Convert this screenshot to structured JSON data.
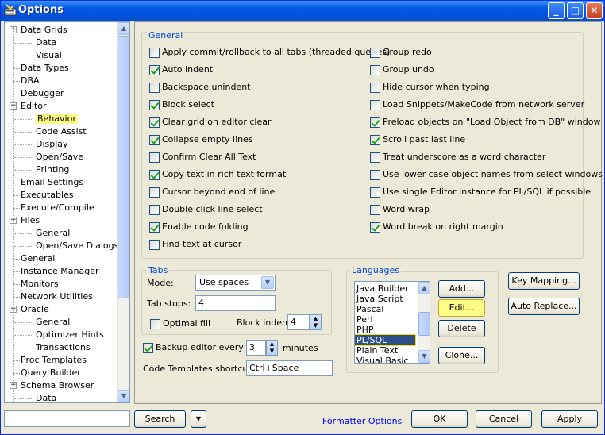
{
  "window": {
    "title": "Options",
    "min": "_",
    "max": "□",
    "close": "✕"
  },
  "tree": {
    "items": [
      {
        "label": "Data Grids",
        "level": 0,
        "expander": "−"
      },
      {
        "label": "Data",
        "level": 1
      },
      {
        "label": "Visual",
        "level": 1
      },
      {
        "label": "Data Types",
        "level": 0
      },
      {
        "label": "DBA",
        "level": 0
      },
      {
        "label": "Debugger",
        "level": 0
      },
      {
        "label": "Editor",
        "level": 0,
        "expander": "−"
      },
      {
        "label": "Behavior",
        "level": 1,
        "selected": true
      },
      {
        "label": "Code Assist",
        "level": 1
      },
      {
        "label": "Display",
        "level": 1
      },
      {
        "label": "Open/Save",
        "level": 1
      },
      {
        "label": "Printing",
        "level": 1
      },
      {
        "label": "Email Settings",
        "level": 0
      },
      {
        "label": "Executables",
        "level": 0
      },
      {
        "label": "Execute/Compile",
        "level": 0
      },
      {
        "label": "Files",
        "level": 0,
        "expander": "−"
      },
      {
        "label": "General",
        "level": 1
      },
      {
        "label": "Open/Save Dialogs",
        "level": 1
      },
      {
        "label": "General",
        "level": 0
      },
      {
        "label": "Instance Manager",
        "level": 0
      },
      {
        "label": "Monitors",
        "level": 0
      },
      {
        "label": "Network Utilities",
        "level": 0
      },
      {
        "label": "Oracle",
        "level": 0,
        "expander": "−"
      },
      {
        "label": "General",
        "level": 1
      },
      {
        "label": "Optimizer Hints",
        "level": 1
      },
      {
        "label": "Transactions",
        "level": 1
      },
      {
        "label": "Proc Templates",
        "level": 0
      },
      {
        "label": "Query Builder",
        "level": 0
      },
      {
        "label": "Schema Browser",
        "level": 0,
        "expander": "−"
      },
      {
        "label": "Data",
        "level": 1
      }
    ]
  },
  "general": {
    "title": "General",
    "left": [
      {
        "label": "Apply commit/rollback to all tabs (threaded queries)",
        "checked": false
      },
      {
        "label": "Auto indent",
        "checked": true
      },
      {
        "label": "Backspace unindent",
        "checked": false
      },
      {
        "label": "Block select",
        "checked": true
      },
      {
        "label": "Clear grid on editor clear",
        "checked": true
      },
      {
        "label": "Collapse empty lines",
        "checked": true
      },
      {
        "label": "Confirm Clear All Text",
        "checked": false
      },
      {
        "label": "Copy text in rich text format",
        "checked": true
      },
      {
        "label": "Cursor beyond end of line",
        "checked": false
      },
      {
        "label": "Double click line select",
        "checked": false
      },
      {
        "label": "Enable code folding",
        "checked": true
      },
      {
        "label": "Find text at cursor",
        "checked": false
      }
    ],
    "right": [
      {
        "label": "Group redo",
        "checked": false
      },
      {
        "label": "Group undo",
        "checked": false
      },
      {
        "label": "Hide cursor when typing",
        "checked": false
      },
      {
        "label": "Load Snippets/MakeCode from network server",
        "checked": false
      },
      {
        "label": "Preload objects on \"Load Object from DB\" window",
        "checked": true
      },
      {
        "label": "Scroll past last line",
        "checked": true
      },
      {
        "label": "Treat underscore as a word character",
        "checked": false
      },
      {
        "label": "Use lower case object names from select windows",
        "checked": false
      },
      {
        "label": "Use single Editor instance for PL/SQL if possible",
        "checked": false
      },
      {
        "label": "Word wrap",
        "checked": false
      },
      {
        "label": "Word break on right margin",
        "checked": true
      }
    ]
  },
  "tabs": {
    "title": "Tabs",
    "mode_label": "Mode:",
    "mode_value": "Use spaces",
    "tabstops_label": "Tab stops:",
    "tabstops_value": "4",
    "optimal_fill": "Optimal fill",
    "block_indent_label": "Block indent:",
    "block_indent_value": "4"
  },
  "backup": {
    "label": "Backup editor every",
    "value": "3",
    "unit": "minutes"
  },
  "code_templates": {
    "label": "Code Templates shortcut:",
    "value": "Ctrl+Space"
  },
  "languages": {
    "title": "Languages",
    "items": [
      "Java Builder",
      "Java Script",
      "Pascal",
      "Perl",
      "PHP",
      "PL/SQL",
      "Plain Text",
      "Visual Basic"
    ],
    "selected": "PL/SQL",
    "add": "Add...",
    "edit": "Edit...",
    "delete": "Delete",
    "clone": "Clone..."
  },
  "side_buttons": {
    "key_mapping": "Key Mapping...",
    "auto_replace": "Auto Replace..."
  },
  "bottom": {
    "search_value": "",
    "search": "Search",
    "dropdown": "▼",
    "formatter_options": "Formatter Options",
    "ok": "OK",
    "cancel": "Cancel",
    "apply": "Apply"
  }
}
